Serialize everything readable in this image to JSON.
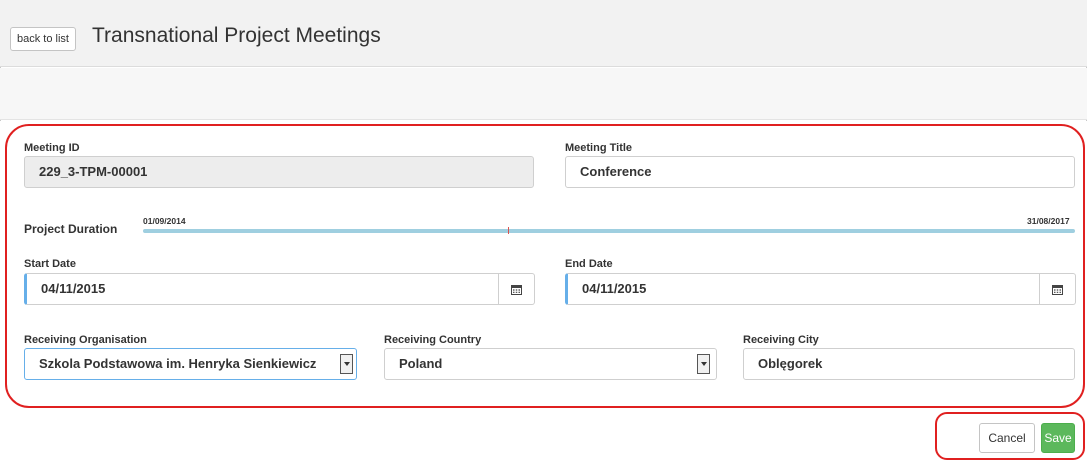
{
  "header": {
    "back_label": "back to list",
    "title": "Transnational Project Meetings"
  },
  "form": {
    "meeting_id": {
      "label": "Meeting ID",
      "value": "229_3-TPM-00001"
    },
    "meeting_title": {
      "label": "Meeting Title",
      "value": "Conference"
    },
    "project_duration": {
      "label": "Project Duration",
      "start": "01/09/2014",
      "end": "31/08/2017"
    },
    "start_date": {
      "label": "Start Date",
      "value": "04/11/2015",
      "icon": "calendar-icon"
    },
    "end_date": {
      "label": "End Date",
      "value": "04/11/2015",
      "icon": "calendar-icon"
    },
    "receiving_organisation": {
      "label": "Receiving Organisation",
      "value": "Szkola Podstawowa im. Henryka Sienkiewicz"
    },
    "receiving_country": {
      "label": "Receiving Country",
      "value": "Poland"
    },
    "receiving_city": {
      "label": "Receiving City",
      "value": "Oblęgorek"
    }
  },
  "actions": {
    "cancel_label": "Cancel",
    "save_label": "Save"
  },
  "colors": {
    "save": "#5cb85c",
    "focus": "#66afe9",
    "annotation": "#e02020",
    "timeline": "#9fcfe0"
  }
}
